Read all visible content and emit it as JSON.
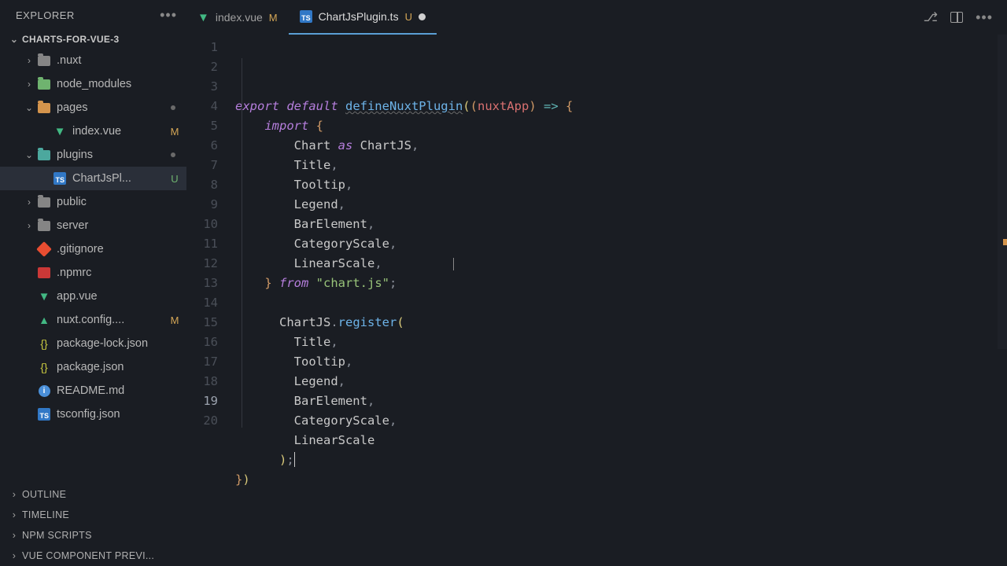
{
  "explorer": {
    "title": "EXPLORER",
    "project": "CHARTS-FOR-VUE-3",
    "tree": [
      {
        "kind": "folder",
        "label": ".nuxt",
        "icon": "gray",
        "expanded": false,
        "indent": 1
      },
      {
        "kind": "folder",
        "label": "node_modules",
        "icon": "green",
        "expanded": false,
        "indent": 1
      },
      {
        "kind": "folder",
        "label": "pages",
        "icon": "orange",
        "expanded": true,
        "indent": 1,
        "dirty": true
      },
      {
        "kind": "file",
        "label": "index.vue",
        "icon": "vue",
        "indent": 2,
        "status": "M"
      },
      {
        "kind": "folder",
        "label": "plugins",
        "icon": "teal",
        "expanded": true,
        "indent": 1,
        "dirty": true
      },
      {
        "kind": "file",
        "label": "ChartJsPl...",
        "icon": "ts",
        "indent": 2,
        "status": "U",
        "active": true
      },
      {
        "kind": "folder",
        "label": "public",
        "icon": "gray",
        "expanded": false,
        "indent": 1
      },
      {
        "kind": "folder",
        "label": "server",
        "icon": "gray",
        "expanded": false,
        "indent": 1
      },
      {
        "kind": "file",
        "label": ".gitignore",
        "icon": "git",
        "indent": 1
      },
      {
        "kind": "file",
        "label": ".npmrc",
        "icon": "npm",
        "indent": 1
      },
      {
        "kind": "file",
        "label": "app.vue",
        "icon": "vue",
        "indent": 1
      },
      {
        "kind": "file",
        "label": "nuxt.config....",
        "icon": "nuxt",
        "indent": 1,
        "status": "M"
      },
      {
        "kind": "file",
        "label": "package-lock.json",
        "icon": "json",
        "indent": 1
      },
      {
        "kind": "file",
        "label": "package.json",
        "icon": "json",
        "indent": 1
      },
      {
        "kind": "file",
        "label": "README.md",
        "icon": "info",
        "indent": 1
      },
      {
        "kind": "file",
        "label": "tsconfig.json",
        "icon": "ts",
        "indent": 1
      }
    ],
    "panels": [
      "OUTLINE",
      "TIMELINE",
      "NPM SCRIPTS",
      "VUE COMPONENT PREVI..."
    ]
  },
  "tabs": [
    {
      "label": "index.vue",
      "icon": "vue",
      "status": "M",
      "active": false
    },
    {
      "label": "ChartJsPlugin.ts",
      "icon": "ts",
      "status": "U",
      "dirty": true,
      "active": true
    }
  ],
  "editor": {
    "currentLine": 19,
    "lineCount": 20,
    "code": [
      [
        [
          "kw-purple",
          "export "
        ],
        [
          "kw-purple",
          "default "
        ],
        [
          "kw-blue underline",
          "defineNuxtPlugin"
        ],
        [
          "kw-yellow",
          "("
        ],
        [
          "kw-orange",
          "("
        ],
        [
          "kw-red",
          "nuxtApp"
        ],
        [
          "kw-orange",
          ")"
        ],
        [
          "kw-teal",
          " => "
        ],
        [
          "kw-orange",
          "{"
        ]
      ],
      [
        [
          "",
          "    "
        ],
        [
          "kw-purple",
          "import "
        ],
        [
          "kw-orange",
          "{"
        ]
      ],
      [
        [
          "",
          "        "
        ],
        [
          "kw-white",
          "Chart "
        ],
        [
          "kw-purple",
          "as "
        ],
        [
          "kw-white",
          "ChartJS"
        ],
        [
          "kw-gray",
          ","
        ]
      ],
      [
        [
          "",
          "        "
        ],
        [
          "kw-white",
          "Title"
        ],
        [
          "kw-gray",
          ","
        ]
      ],
      [
        [
          "",
          "        "
        ],
        [
          "kw-white",
          "Tooltip"
        ],
        [
          "kw-gray",
          ","
        ]
      ],
      [
        [
          "",
          "        "
        ],
        [
          "kw-white",
          "Legend"
        ],
        [
          "kw-gray",
          ","
        ]
      ],
      [
        [
          "",
          "        "
        ],
        [
          "kw-white",
          "BarElement"
        ],
        [
          "kw-gray",
          ","
        ]
      ],
      [
        [
          "",
          "        "
        ],
        [
          "kw-white",
          "CategoryScale"
        ],
        [
          "kw-gray",
          ","
        ]
      ],
      [
        [
          "",
          "        "
        ],
        [
          "kw-white",
          "LinearScale"
        ],
        [
          "kw-gray",
          ","
        ]
      ],
      [
        [
          "",
          "    "
        ],
        [
          "kw-orange",
          "}"
        ],
        [
          "kw-purple",
          " from "
        ],
        [
          "kw-string",
          "\"chart.js\""
        ],
        [
          "kw-gray",
          ";"
        ]
      ],
      [],
      [
        [
          "",
          "      "
        ],
        [
          "kw-white",
          "ChartJS"
        ],
        [
          "kw-gray",
          "."
        ],
        [
          "kw-blue",
          "register"
        ],
        [
          "kw-yellow",
          "("
        ]
      ],
      [
        [
          "",
          "        "
        ],
        [
          "kw-white",
          "Title"
        ],
        [
          "kw-gray",
          ","
        ]
      ],
      [
        [
          "",
          "        "
        ],
        [
          "kw-white",
          "Tooltip"
        ],
        [
          "kw-gray",
          ","
        ]
      ],
      [
        [
          "",
          "        "
        ],
        [
          "kw-white",
          "Legend"
        ],
        [
          "kw-gray",
          ","
        ]
      ],
      [
        [
          "",
          "        "
        ],
        [
          "kw-white",
          "BarElement"
        ],
        [
          "kw-gray",
          ","
        ]
      ],
      [
        [
          "",
          "        "
        ],
        [
          "kw-white",
          "CategoryScale"
        ],
        [
          "kw-gray",
          ","
        ]
      ],
      [
        [
          "",
          "        "
        ],
        [
          "kw-white",
          "LinearScale"
        ]
      ],
      [
        [
          "",
          "      "
        ],
        [
          "kw-yellow",
          ")"
        ],
        [
          "kw-gray",
          ";"
        ]
      ],
      [
        [
          "kw-orange",
          "}"
        ],
        [
          "kw-yellow",
          ")"
        ]
      ]
    ]
  }
}
